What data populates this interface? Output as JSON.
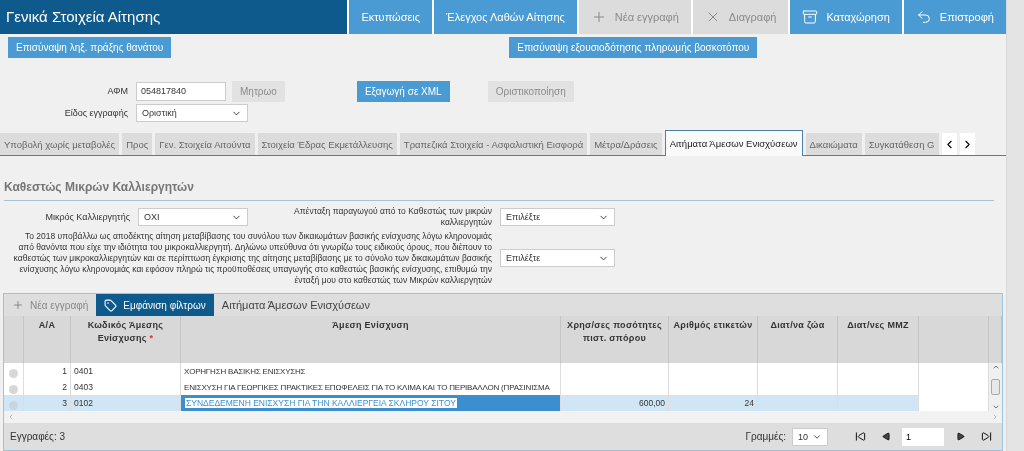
{
  "header": {
    "title": "Γενικά Στοιχεία Αίτησης",
    "buttons": [
      {
        "label": "Εκτυπώσεις",
        "kind": "plain",
        "disabled": false
      },
      {
        "label": "Έλεγχος Λαθών Αίτησης",
        "kind": "plain",
        "disabled": false
      },
      {
        "label": "Νέα εγγραφή",
        "kind": "new",
        "disabled": true
      },
      {
        "label": "Διαγραφή",
        "kind": "delete",
        "disabled": true
      },
      {
        "label": "Καταχώρηση",
        "kind": "save",
        "disabled": false
      },
      {
        "label": "Επιστροφή",
        "kind": "back",
        "disabled": false
      }
    ]
  },
  "attach_buttons": [
    "Επισύναψη ληξ. πράξης θανάτου",
    "Επισύναψη εξουσιοδότησης πληρωμής βοσκοτόπου"
  ],
  "afm": {
    "label": "ΑΦΜ",
    "value": "054817840"
  },
  "record_type": {
    "label": "Είδος εγγραφής",
    "value": "Οριστική"
  },
  "actions": [
    {
      "label": "Μητρωο",
      "disabled": true
    },
    {
      "label": "Εξαγωγή σε XML",
      "disabled": false
    },
    {
      "label": "Οριστικοποίηση",
      "disabled": true
    }
  ],
  "tabs": [
    {
      "label": "Υποβολή χωρίς μεταβολές",
      "selected": false
    },
    {
      "label": "Προς",
      "selected": false
    },
    {
      "label": "Γεν. Στοιχεία Αιτούντα",
      "selected": false
    },
    {
      "label": "Στοιχεία Έδρας Εκμετάλλευσης",
      "selected": false
    },
    {
      "label": "Τραπεζικά Στοιχεία - Ασφαλιστική Εισφορά",
      "selected": false
    },
    {
      "label": "Μέτρα/Δράσεις",
      "selected": false
    },
    {
      "label": "Αιτήματα Άμεσων Ενισχύσεων",
      "selected": true
    },
    {
      "label": "Δικαιώματα",
      "selected": false
    },
    {
      "label": "Συγκατάθεση G",
      "selected": false
    }
  ],
  "section": {
    "title": "Καθεστώς Μικρών Καλλιεργητών",
    "small_farmer": {
      "label": "Μικρός Καλλιεργητής",
      "value": "ΟΧΙ"
    },
    "exclusion": {
      "label": "Απένταξη παραγωγού από το Καθεστώς των μικρών καλλιεργητών",
      "value": "Επιλέξτε"
    },
    "declaration": {
      "label": "Το 2018 υποβάλλω ως αποδέκτης αίτηση μεταβίβασης του συνόλου των δικαιωμάτων βασικής ενίσχυσης λόγω κληρονομιάς από θανόντα που είχε την ιδιότητα του μικροκαλλιεργητή. Δηλώνω υπεύθυνα ότι γνωρίζω τους ειδικούς όρους, που διέπουν το καθεστώς των μικροκαλλιεργητών και σε περίπτωση έγκρισης της αίτησης μεταβίβασης με το σύνολο των δικαιωμάτων βασικής ενίσχυσης λόγω κληρονομιάς και εφόσον πληρώ τις προϋποθέσεις υπαγωγής στο καθεστώς βασικής ενίσχυσης, επιθυμώ την ένταξή μου στο καθεστώς των Μικρών καλλιεργητών",
      "value": "Επιλέξτε"
    }
  },
  "grid": {
    "new_button": {
      "label": "Νέα εγγραφή",
      "disabled": true
    },
    "filter_button": "Εμφάνιση φίλτρων",
    "title": "Αιτήματα Άμεσων Ενισχύσεων",
    "columns": [
      {
        "label": "Α/Α"
      },
      {
        "label": "Κωδικός Άμεσης Ενίσχυσης",
        "required_mark": "*"
      },
      {
        "label": "Άμεση Ενίσχυση"
      },
      {
        "label": "Χρησ/σες ποσότητες πιστ. σπόρου"
      },
      {
        "label": "Αριθμός ετικετών"
      },
      {
        "label": "Διατ/να ζώα"
      },
      {
        "label": "Διατ/νες ΜΜΖ"
      }
    ],
    "rows": [
      {
        "index": "1",
        "code": "0401",
        "description": "ΧΟΡΗΓΗΣΗ  ΒΑΣΙΚΗΣ ΕΝΙΣΧΥΣΗΣ",
        "seed": "",
        "labels": "",
        "selected": false
      },
      {
        "index": "2",
        "code": "0403",
        "description": "ΕΝΙΣΧΥΣΗ ΓΙΑ ΓΕΩΡΓΙΚΕΣ ΠΡΑΚΤΙΚΕΣ ΕΠΩΦΕΛΕΙΣ ΓΙΑ ΤΟ ΚΛΙΜΑ ΚΑΙ ΤΟ ΠΕΡΙΒΑΛΛΟΝ (ΠΡΑΣΙΝΙΣΜΑ",
        "seed": "",
        "labels": "",
        "selected": false
      },
      {
        "index": "3",
        "code": "0102",
        "description": "ΣΥΝΔΕΔΕΜΕΝΗ ΕΝΙΣΧΥΣΗ ΓΙΑ ΤΗΝ ΚΑΛΛΙΕΡΓΕΙΑ ΣΚΛΗΡΟΥ ΣΙΤΟΥ",
        "seed": "600,00",
        "labels": "24",
        "selected": true
      }
    ],
    "records": "Εγγραφές: 3",
    "rows_label": "Γραμμές:",
    "page_size": "10",
    "page": "1"
  }
}
